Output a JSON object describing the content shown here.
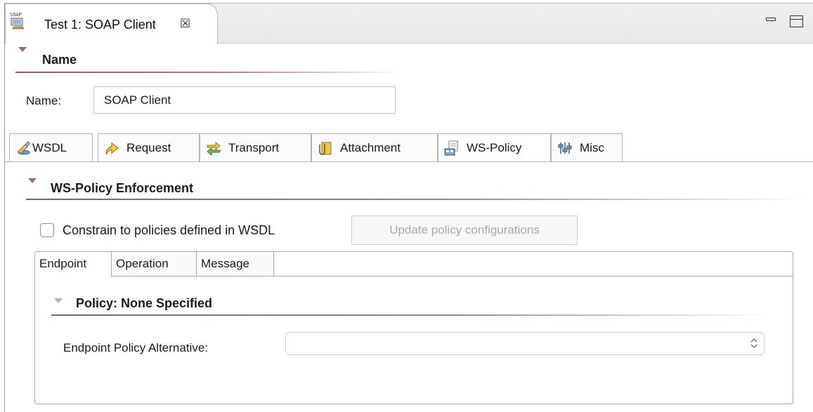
{
  "editor_tab": {
    "title": "Test 1: SOAP Client",
    "icon": "soap-client-icon",
    "close_glyph": "☒"
  },
  "window_controls": {
    "minimize": "minimize-icon",
    "maximize": "maximize-icon"
  },
  "name_section": {
    "title": "Name",
    "field_label": "Name:",
    "field_value": "SOAP Client"
  },
  "main_tabs": [
    {
      "label": "WSDL",
      "icon": "wsdl-icon",
      "active": false
    },
    {
      "label": "Request",
      "icon": "request-icon",
      "active": false
    },
    {
      "label": "Transport",
      "icon": "transport-icon",
      "active": false
    },
    {
      "label": "Attachment",
      "icon": "attachment-icon",
      "active": false
    },
    {
      "label": "WS-Policy",
      "icon": "ws-policy-icon",
      "active": true
    },
    {
      "label": "Misc",
      "icon": "misc-icon",
      "active": false
    }
  ],
  "ws_policy": {
    "section_title": "WS-Policy Enforcement",
    "constrain_label": "Constrain to policies defined in WSDL",
    "constrain_checked": false,
    "update_button": "Update policy configurations",
    "sub_tabs": [
      {
        "label": "Endpoint",
        "active": true
      },
      {
        "label": "Operation",
        "active": false
      },
      {
        "label": "Message",
        "active": false
      }
    ],
    "policy_title": "Policy: None Specified",
    "endpoint_alt_label": "Endpoint Policy Alternative:",
    "endpoint_alt_value": ""
  },
  "colors": {
    "accent_rule": "#8a5f5f",
    "twistie": "#9d6b6b"
  }
}
